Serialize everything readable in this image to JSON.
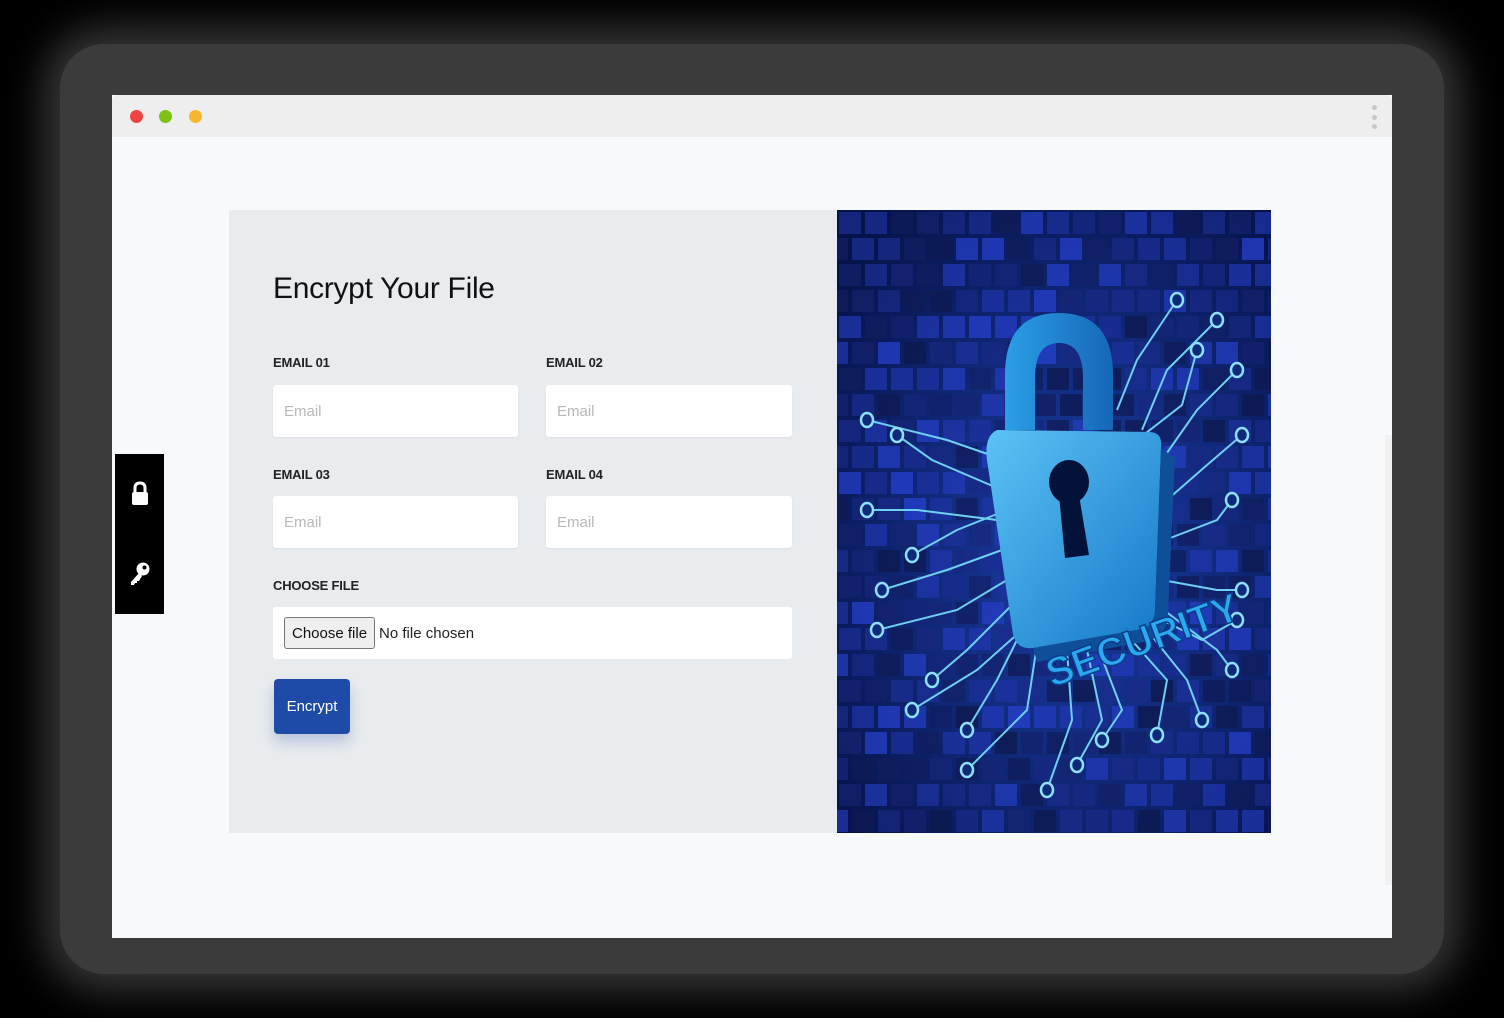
{
  "window": {
    "controls": [
      "close",
      "minimize",
      "maximize"
    ],
    "menu_icon": "kebab-menu-icon"
  },
  "form": {
    "title": "Encrypt Your File",
    "fields": [
      {
        "label": "EMAIL 01",
        "placeholder": "Email",
        "value": ""
      },
      {
        "label": "EMAIL 02",
        "placeholder": "Email",
        "value": ""
      },
      {
        "label": "EMAIL 03",
        "placeholder": "Email",
        "value": ""
      },
      {
        "label": "EMAIL 04",
        "placeholder": "Email",
        "value": ""
      }
    ],
    "file": {
      "label": "CHOOSE FILE",
      "button_label": "Choose file",
      "status": "No file chosen"
    },
    "submit_label": "Encrypt"
  },
  "illustration": {
    "word": "SECURITY",
    "icon": "padlock-circuit-illustration"
  },
  "side_toolbar": {
    "items": [
      {
        "icon": "lock-icon"
      },
      {
        "icon": "key-icon"
      }
    ]
  },
  "colors": {
    "accent": "#1e4aa8",
    "panel": "#e9ecef",
    "page": "#f8f9fa",
    "lock": "#2ea3ea"
  }
}
